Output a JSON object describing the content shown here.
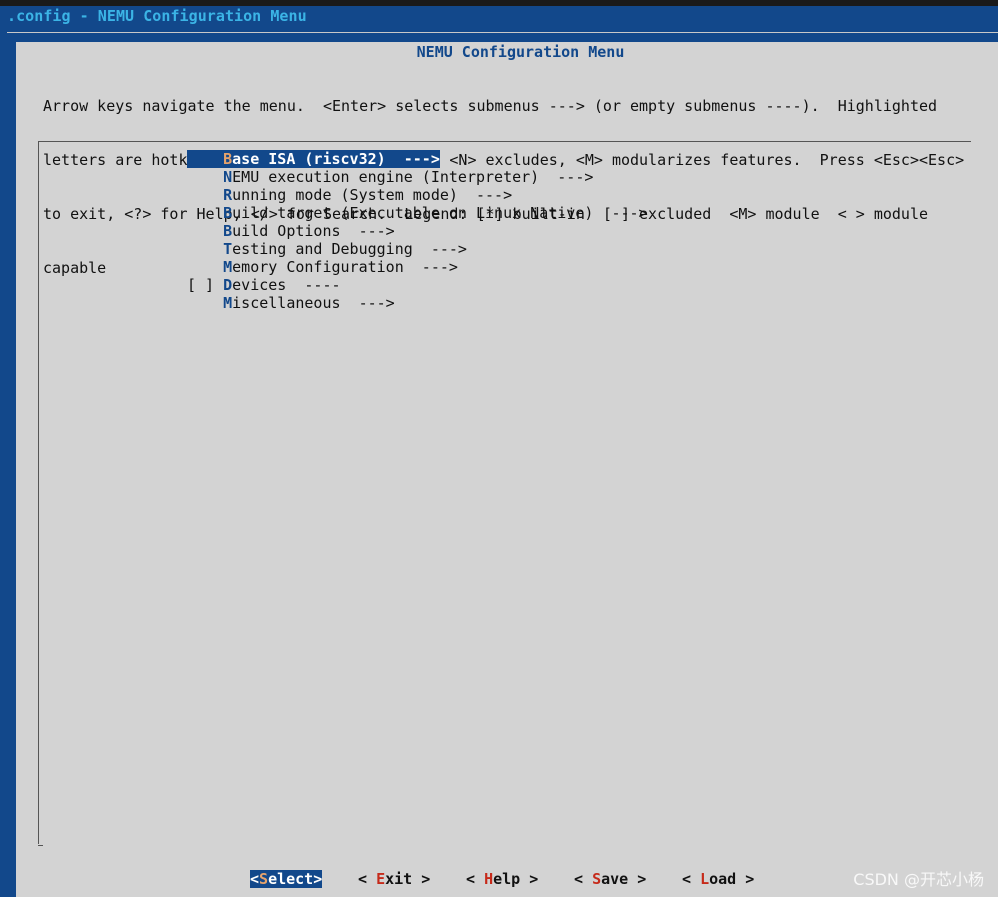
{
  "window": {
    "title": ".config - NEMU Configuration Menu"
  },
  "dialog": {
    "title": "NEMU Configuration Menu",
    "help_lines": [
      "Arrow keys navigate the menu.  <Enter> selects submenus ---> (or empty submenus ----).  Highlighted",
      "letters are hotkeys.  Pressing <Y> includes, <N> excludes, <M> modularizes features.  Press <Esc><Esc>",
      "to exit, <?> for Help, </> for Search.  Legend: [*] built-in  [ ] excluded  <M> module  < > module",
      "capable"
    ]
  },
  "menu": [
    {
      "prefix": "    ",
      "hotkey": "B",
      "rest": "ase ISA (riscv32)  --->",
      "selected": true
    },
    {
      "prefix": "    ",
      "hotkey": "N",
      "rest": "EMU execution engine (Interpreter)  --->",
      "selected": false
    },
    {
      "prefix": "    ",
      "hotkey": "R",
      "rest": "unning mode (System mode)  --->",
      "selected": false
    },
    {
      "prefix": "    ",
      "hotkey": "B",
      "rest": "uild target (Executable on Linux Native)  --->",
      "selected": false
    },
    {
      "prefix": "    ",
      "hotkey": "B",
      "rest": "uild Options  --->",
      "selected": false
    },
    {
      "prefix": "    ",
      "hotkey": "T",
      "rest": "esting and Debugging  --->",
      "selected": false
    },
    {
      "prefix": "    ",
      "hotkey": "M",
      "rest": "emory Configuration  --->",
      "selected": false
    },
    {
      "prefix": "[ ] ",
      "hotkey": "D",
      "rest": "evices  ----",
      "selected": false
    },
    {
      "prefix": "    ",
      "hotkey": "M",
      "rest": "iscellaneous  --->",
      "selected": false
    }
  ],
  "buttons": [
    {
      "pre": "<",
      "hotkey": "S",
      "rest": "elect>",
      "selected": true
    },
    {
      "pre": "< ",
      "hotkey": "E",
      "rest": "xit >",
      "selected": false
    },
    {
      "pre": "< ",
      "hotkey": "H",
      "rest": "elp >",
      "selected": false
    },
    {
      "pre": "< ",
      "hotkey": "S",
      "rest": "ave >",
      "selected": false
    },
    {
      "pre": "< ",
      "hotkey": "L",
      "rest": "oad >",
      "selected": false
    }
  ],
  "watermark": "CSDN @开芯小杨",
  "colors": {
    "terminal_bg": "#12488b",
    "dialog_bg": "#d3d3d3",
    "hotkey_menu": "#12488b",
    "hotkey_button": "#c62a1a",
    "selected_hotkey": "#e6a36c"
  }
}
